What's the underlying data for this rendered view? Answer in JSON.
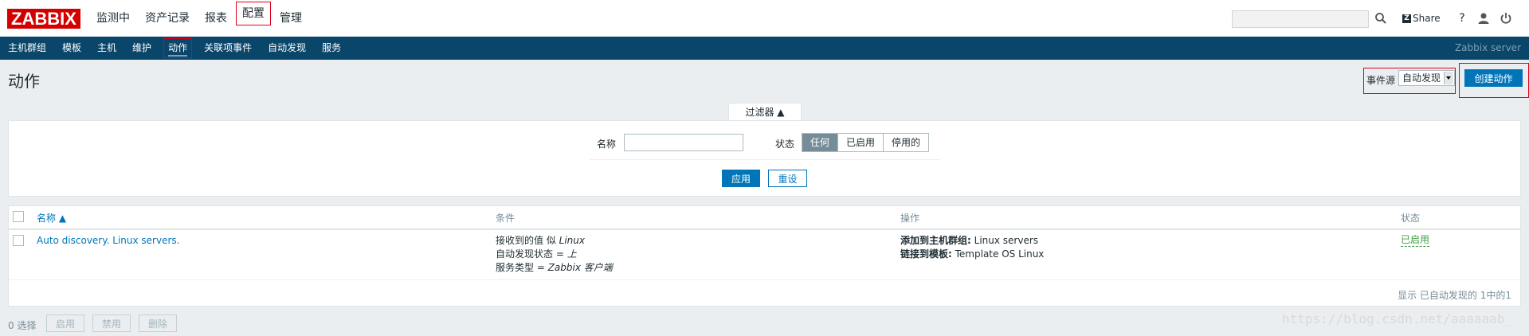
{
  "header": {
    "logo": "ZABBIX",
    "menu": [
      "监测中",
      "资产记录",
      "报表",
      "配置",
      "管理"
    ],
    "share": "Share",
    "help": "?"
  },
  "subnav": {
    "items": [
      "主机群组",
      "模板",
      "主机",
      "维护",
      "动作",
      "关联项事件",
      "自动发现",
      "服务"
    ],
    "server": "Zabbix server"
  },
  "page": {
    "title": "动作",
    "event_source_label": "事件源",
    "event_source_value": "自动发现",
    "create_button": "创建动作"
  },
  "filter": {
    "tab_label": "过滤器 ▲",
    "name_label": "名称",
    "name_value": "",
    "status_label": "状态",
    "status_options": [
      "任何",
      "已启用",
      "停用的"
    ],
    "apply": "应用",
    "reset": "重设"
  },
  "table": {
    "headers": {
      "name": "名称 ▲",
      "conditions": "条件",
      "operations": "操作",
      "status": "状态"
    },
    "rows": [
      {
        "name": "Auto discovery. Linux servers.",
        "conditions": [
          {
            "text": "接收到的值 似 ",
            "em": "Linux"
          },
          {
            "text": "自动发现状态 = ",
            "em": "上"
          },
          {
            "text": "服务类型 = ",
            "em": "Zabbix 客户端"
          }
        ],
        "operations": [
          {
            "bold": "添加到主机群组:",
            "text": " Linux servers"
          },
          {
            "bold": "链接到模板:",
            "text": " Template OS Linux"
          }
        ],
        "status": "已启用"
      }
    ],
    "footer": "显示 已自动发现的 1中的1"
  },
  "bottom": {
    "selected": "0 选择",
    "buttons": [
      "启用",
      "禁用",
      "删除"
    ]
  },
  "watermark": "https://blog.csdn.net/aaaaaab_",
  "colors": {
    "brand": "#d40000",
    "nav": "#0a466a",
    "primary": "#0275b8",
    "enabled": "#429e47",
    "highlight": "#e0001a"
  }
}
